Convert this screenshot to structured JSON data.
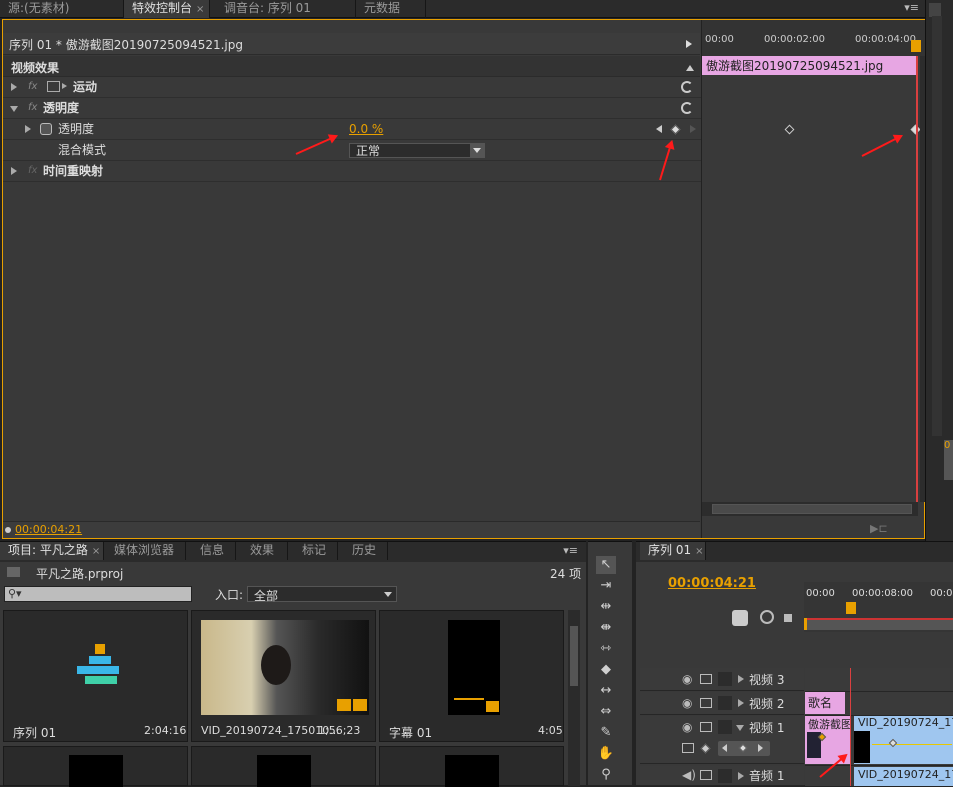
{
  "top_tabs": [
    {
      "label": "源:(无素材)",
      "active": false
    },
    {
      "label": "特效控制台",
      "active": true
    },
    {
      "label": "调音台: 序列 01",
      "active": false
    },
    {
      "label": "元数据",
      "active": false
    }
  ],
  "effects": {
    "clip_title": "序列 01 * 傲游截图20190725094521.jpg",
    "section": "视频效果",
    "rows": {
      "motion": "运动",
      "opacity_group": "透明度",
      "opacity_param": "透明度",
      "opacity_value": "0.0 %",
      "blend_label": "混合模式",
      "blend_value": "正常",
      "time_remap": "时间重映射"
    },
    "timecode": "00:00:04:21",
    "ruler": [
      "00:00",
      "00:00:02:00",
      "00:00:04:00"
    ],
    "clip_bar": "傲游截图20190725094521.jpg"
  },
  "project": {
    "tabs": [
      "项目: 平凡之路",
      "媒体浏览器",
      "信息",
      "效果",
      "标记",
      "历史"
    ],
    "file": "平凡之路.prproj",
    "count": "24 项",
    "search_placeholder": "",
    "in_label": "入口:",
    "in_value": "全部",
    "items": [
      {
        "name": "序列 01",
        "duration": "2:04:16"
      },
      {
        "name": "VID_20190724_175010...",
        "duration": "1;56;23"
      },
      {
        "name": "字幕 01",
        "duration": "4:05"
      }
    ]
  },
  "timeline": {
    "tab": "序列 01",
    "timecode": "00:00:04:21",
    "ruler": [
      "00:00",
      "00:00:08:00",
      "00:0"
    ],
    "tracks": {
      "v3": "视频 3",
      "v2": "视频 2",
      "v1": "视频 1",
      "a1": "音频 1"
    },
    "clips": {
      "title_clip": "歌名",
      "image_clip": "傲游截图",
      "video_clip": "VID_20190724_175",
      "audio_clip": "VID_20190724_175"
    }
  },
  "colors": {
    "accent": "#e8a000",
    "clip_pink": "#e7a6e3",
    "clip_blue": "#9fc6ef",
    "arrow": "#ff1a1a",
    "playhead": "#d94040"
  }
}
